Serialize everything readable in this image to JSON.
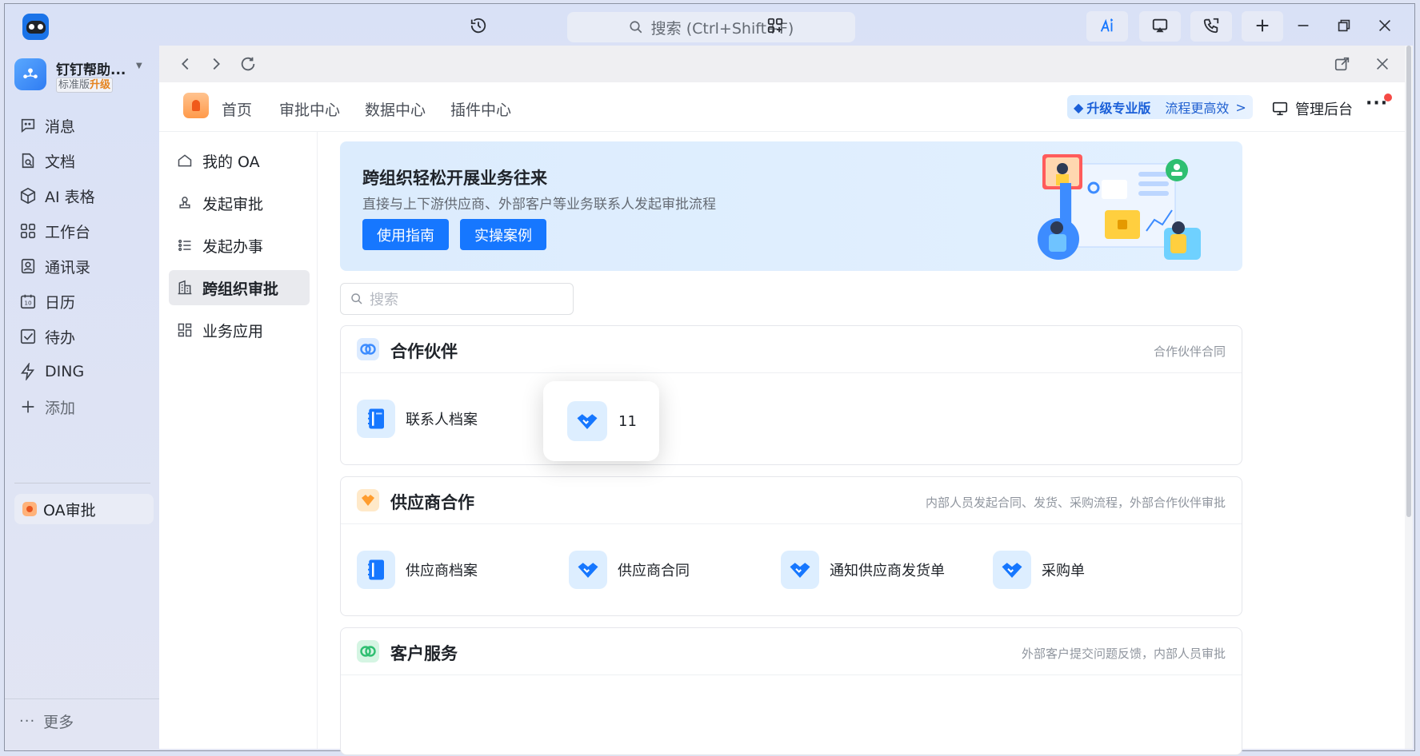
{
  "titlebar": {
    "search_placeholder": "搜索 (Ctrl+Shift+F)",
    "icons": [
      "history-icon",
      "search-icon",
      "apps-add-icon",
      "ai-icon",
      "screen-cast-icon",
      "phone-icon",
      "plus-icon",
      "minimize-icon",
      "restore-icon",
      "close-icon"
    ]
  },
  "org": {
    "name": "钉钉帮助...",
    "tag": "标准版",
    "tag_upgrade": "升级"
  },
  "leftnav": {
    "items": [
      {
        "label": "消息",
        "icon": "message-icon"
      },
      {
        "label": "文档",
        "icon": "document-icon"
      },
      {
        "label": "AI 表格",
        "icon": "ai-table-icon"
      },
      {
        "label": "工作台",
        "icon": "workbench-icon"
      },
      {
        "label": "通讯录",
        "icon": "contacts-icon"
      },
      {
        "label": "日历",
        "icon": "calendar-icon"
      },
      {
        "label": "待办",
        "icon": "todo-icon"
      },
      {
        "label": "DING",
        "icon": "ding-icon"
      },
      {
        "label": "添加",
        "icon": "add-icon"
      }
    ],
    "pinned_app": "OA审批",
    "more": "更多"
  },
  "oa": {
    "tabs": [
      "首页",
      "审批中心",
      "数据中心",
      "插件中心"
    ],
    "upgrade_main": "升级专业版",
    "upgrade_sub": "流程更高效",
    "upgrade_arrow": ">",
    "admin": "管理后台",
    "more": "···",
    "side": [
      {
        "label": "我的 OA",
        "icon": "home-icon"
      },
      {
        "label": "发起审批",
        "icon": "stamp-icon"
      },
      {
        "label": "发起办事",
        "icon": "list-icon"
      },
      {
        "label": "跨组织审批",
        "icon": "building-icon"
      },
      {
        "label": "业务应用",
        "icon": "grid-apps-icon"
      }
    ],
    "active_side": "跨组织审批"
  },
  "banner": {
    "title": "跨组织轻松开展业务往来",
    "subtitle": "直接与上下游供应商、外部客户等业务联系人发起审批流程",
    "btn_guide": "使用指南",
    "btn_cases": "实操案例"
  },
  "search": {
    "placeholder": "搜索"
  },
  "sections": [
    {
      "title": "合作伙伴",
      "desc": "合作伙伴合同",
      "color": "#3d8cff",
      "apps": [
        {
          "label": "联系人档案",
          "icon": "file-icon"
        }
      ]
    },
    {
      "title": "供应商合作",
      "desc": "内部人员发起合同、发货、采购流程，外部合作伙伴审批",
      "color": "#ff9d2e",
      "apps": [
        {
          "label": "供应商档案",
          "icon": "file-icon"
        },
        {
          "label": "供应商合同",
          "icon": "handshake-icon"
        },
        {
          "label": "通知供应商发货单",
          "icon": "handshake-icon"
        },
        {
          "label": "采购单",
          "icon": "handshake-icon"
        }
      ]
    },
    {
      "title": "客户服务",
      "desc": "外部客户提交问题反馈，内部人员审批",
      "color": "#2fbf71",
      "apps": []
    }
  ],
  "floating_card": {
    "label": "11",
    "icon": "handshake-icon"
  },
  "colors": {
    "primary": "#1677ff",
    "accent_orange": "#ff9d2e",
    "accent_green": "#2fbf71"
  }
}
